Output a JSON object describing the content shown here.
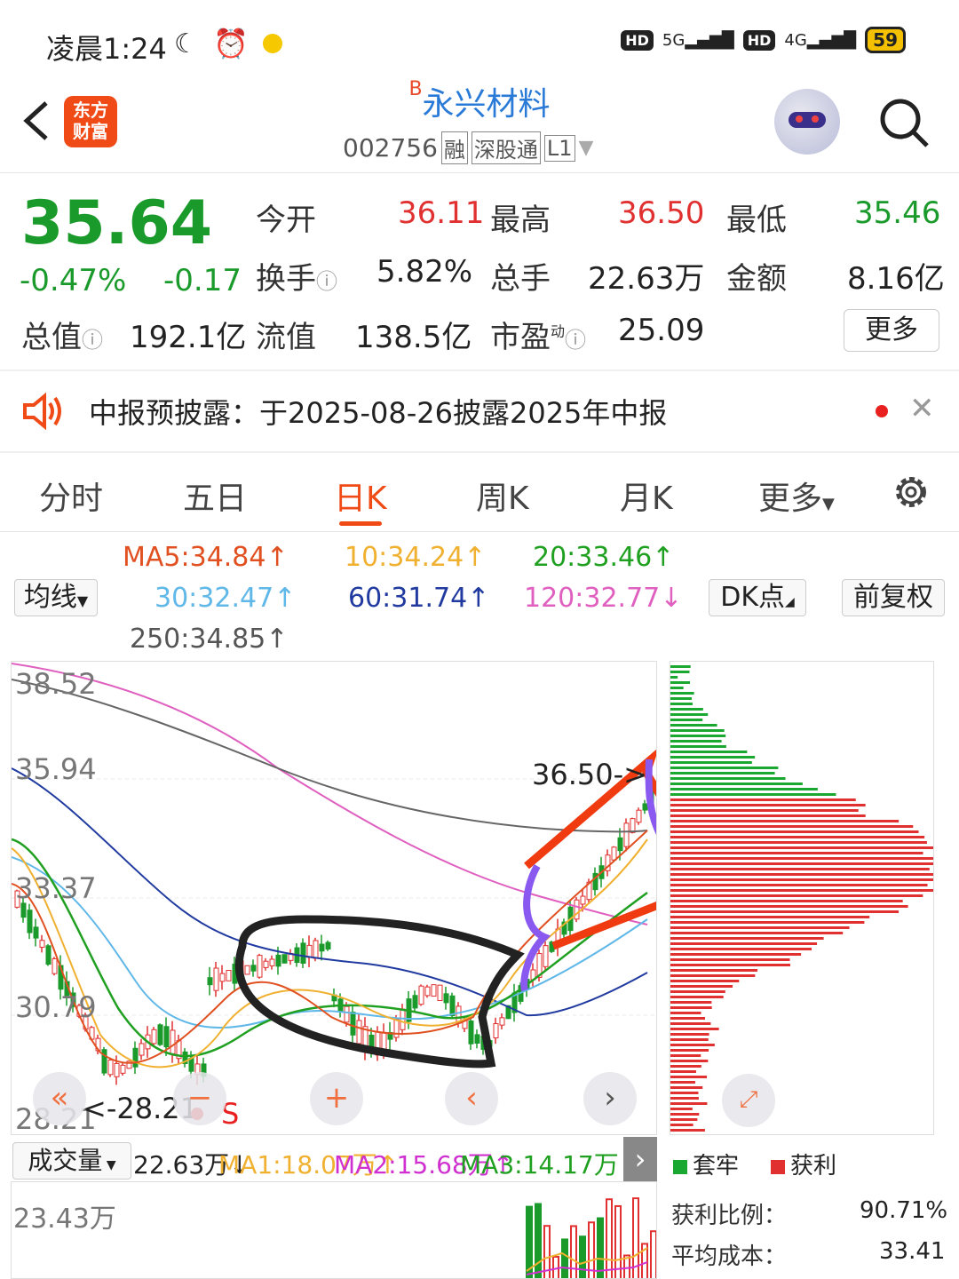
{
  "status": {
    "time": "凌晨1:24",
    "net1": "5G",
    "net2": "4G",
    "hd": "HD",
    "battery": "59"
  },
  "header": {
    "logo_line1": "东方",
    "logo_line2": "财富",
    "title_prefix": "B",
    "title": "永兴材料",
    "code": "002756",
    "tags": [
      "融",
      "深股通",
      "L1"
    ]
  },
  "quote": {
    "price": "35.64",
    "pct": "-0.47%",
    "chg": "-0.17",
    "open_label": "今开",
    "open": "36.11",
    "high_label": "最高",
    "high": "36.50",
    "low_label": "最低",
    "low": "35.46",
    "turnover_label": "换手",
    "turnover": "5.82%",
    "volume_label": "总手",
    "volume": "22.63万",
    "amount_label": "金额",
    "amount": "8.16亿",
    "mktcap_label": "总值",
    "mktcap": "192.1亿",
    "float_label": "流值",
    "float": "138.5亿",
    "pe_label": "市盈",
    "pe_sup": "动",
    "pe": "25.09",
    "more": "更多"
  },
  "notice": {
    "text": "中报预披露：于2025-08-26披露2025年中报"
  },
  "tabs": [
    "分时",
    "五日",
    "日K",
    "周K",
    "月K",
    "更多"
  ],
  "ma": {
    "ma5": "MA5:34.84↑",
    "ma10": "10:34.24↑",
    "ma20": "20:33.46↑",
    "ma30": "30:32.47↑",
    "ma60": "60:31.74↑",
    "ma120": "120:32.77↓",
    "ma250": "250:34.85↑",
    "selector": "均线",
    "dk": "DK点",
    "adjust": "前复权"
  },
  "colors": {
    "ma5": "#e05020",
    "ma10": "#f0b030",
    "ma20": "#20a020",
    "ma30": "#60b8e8",
    "ma60": "#203aa0",
    "ma120": "#e060c0",
    "ma250": "#666666",
    "up": "#e03030",
    "down": "#1a9a2a"
  },
  "chart": {
    "y_labels": [
      "38.52",
      "35.94",
      "33.37",
      "30.79",
      "28.21"
    ],
    "high_mark": "36.50",
    "low_mark": "<-28.21",
    "s_mark": "S"
  },
  "volume": {
    "selector": "成交量",
    "vol": "22.63万↓",
    "ma1": "MA1:18.07万↑",
    "ma2": "MA2:15.68万↑",
    "ma3": "MA3:14.17万↑",
    "ymax": "23.43万"
  },
  "distribution": {
    "legend_trapped": "套牢",
    "legend_profit": "获利",
    "profit_ratio_label": "获利比例：",
    "profit_ratio": "90.71%",
    "avg_cost_label": "平均成本：",
    "avg_cost": "33.41"
  }
}
